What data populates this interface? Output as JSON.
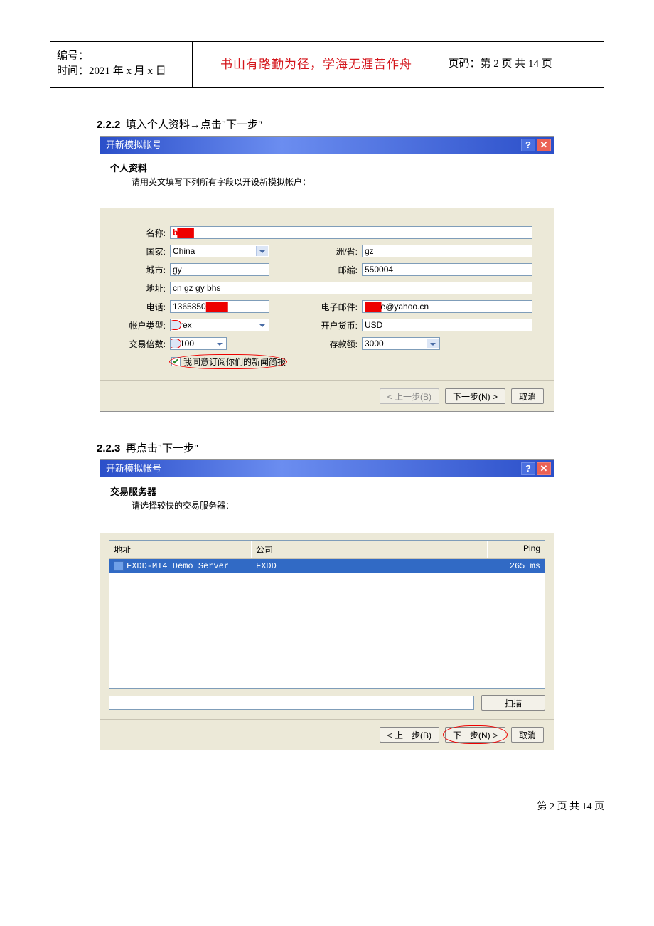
{
  "header": {
    "bianhao_label": "编号：",
    "time_label": "时间：2021 年 x 月 x 日",
    "motto": "书山有路勤为径，学海无涯苦作舟",
    "page_label": "页码：第 2 页  共 14 页"
  },
  "section1": {
    "num": "2.2.2",
    "text": "填入个人资料→点击\"下一步\""
  },
  "dlg1": {
    "title": "开新模拟帐号",
    "sec_title": "个人资料",
    "sec_sub": "请用英文填写下列所有字段以开设新模拟帐户：",
    "labels": {
      "name": "名称:",
      "country": "国家:",
      "state": "洲/省:",
      "city": "城市:",
      "zip": "邮编:",
      "addr": "地址:",
      "phone": "电话:",
      "email": "电子邮件:",
      "acct": "帐户类型:",
      "currency": "开户货币:",
      "lev": "交易倍数:",
      "deposit": "存款额:"
    },
    "values": {
      "name": "b███",
      "country": "China",
      "state": "gz",
      "city": "gy",
      "zip": "550004",
      "addr": "cn gz gy bhs",
      "phone_prefix": "1365850",
      "phone_smudge": "████",
      "email_smudge": "███",
      "email_suffix": "e@yahoo.cn",
      "acct": "forex",
      "currency": "USD",
      "lev": "1:100",
      "deposit": "3000"
    },
    "consent": "我同意订阅你们的新闻简报",
    "btns": {
      "back": "< 上一步(B)",
      "next": "下一步(N) >",
      "cancel": "取消"
    }
  },
  "section2": {
    "num": "2.2.3",
    "text": "再点击\"下一步\""
  },
  "dlg2": {
    "title": "开新模拟帐号",
    "sec_title": "交易服务器",
    "sec_sub": "请选择较快的交易服务器：",
    "cols": {
      "addr": "地址",
      "comp": "公司",
      "ping": "Ping"
    },
    "row": {
      "addr": "FXDD-MT4 Demo Server",
      "comp": "FXDD",
      "ping": "265 ms"
    },
    "scan": "扫描",
    "btns": {
      "back": "< 上一步(B)",
      "next": "下一步(N) >",
      "cancel": "取消"
    }
  },
  "footer": "第 2 页 共 14 页"
}
